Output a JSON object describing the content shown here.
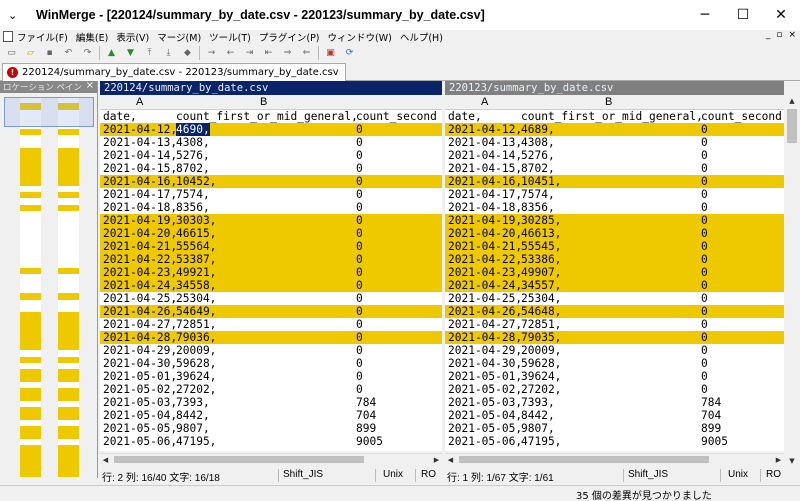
{
  "window": {
    "title": "WinMerge - [220124/summary_by_date.csv - 220123/summary_by_date.csv]",
    "sys_menu_glyph": "⌄",
    "controls": {
      "minimize": "─",
      "maximize": "☐",
      "close": "✕"
    }
  },
  "menu": {
    "items": [
      "ファイル(F)",
      "編集(E)",
      "表示(V)",
      "マージ(M)",
      "ツール(T)",
      "プラグイン(P)",
      "ウィンドウ(W)",
      "ヘルプ(H)"
    ],
    "mdi": {
      "minimize": "_",
      "restore": "▫",
      "close": "×"
    }
  },
  "toolbar": {
    "icons": [
      "new-icon",
      "open-icon",
      "save-icon",
      "undo-icon",
      "redo-icon",
      "previous-diff-icon",
      "next-diff-icon",
      "first-diff-icon",
      "last-diff-icon",
      "current-diff-icon",
      "copy-right-icon",
      "copy-left-icon",
      "copy-right-advance-icon",
      "copy-left-advance-icon",
      "copy-all-right-icon",
      "copy-all-left-icon",
      "options-icon",
      "refresh-icon"
    ]
  },
  "tab": {
    "label": "220124/summary_by_date.csv - 220123/summary_by_date.csv"
  },
  "location_pane": {
    "title": "ロケーション ペイン",
    "close": "×"
  },
  "colors": {
    "diff": "#efc900",
    "active_header": "#0a246a",
    "inactive_header": "#808080"
  },
  "left": {
    "path": "220124/summary_by_date.csv",
    "col_a": "A",
    "col_b": "B",
    "rows": [
      {
        "c1": "date,",
        "c2": "count_first_or_mid_general,",
        "c3": "count_second",
        "diff": false
      },
      {
        "c1": "2021-04-12,",
        "c2": "4690,",
        "c3": "0",
        "diff": true
      },
      {
        "c1": "2021-04-13,",
        "c2": "4308,",
        "c3": "0",
        "diff": false
      },
      {
        "c1": "2021-04-14,",
        "c2": "5276,",
        "c3": "0",
        "diff": false
      },
      {
        "c1": "2021-04-15,",
        "c2": "8702,",
        "c3": "0",
        "diff": false
      },
      {
        "c1": "2021-04-16,",
        "c2": "10452,",
        "c3": "0",
        "diff": true
      },
      {
        "c1": "2021-04-17,",
        "c2": "7574,",
        "c3": "0",
        "diff": false
      },
      {
        "c1": "2021-04-18,",
        "c2": "8356,",
        "c3": "0",
        "diff": false
      },
      {
        "c1": "2021-04-19,",
        "c2": "30303,",
        "c3": "0",
        "diff": true
      },
      {
        "c1": "2021-04-20,",
        "c2": "46615,",
        "c3": "0",
        "diff": true
      },
      {
        "c1": "2021-04-21,",
        "c2": "55564,",
        "c3": "0",
        "diff": true
      },
      {
        "c1": "2021-04-22,",
        "c2": "53387,",
        "c3": "0",
        "diff": true
      },
      {
        "c1": "2021-04-23,",
        "c2": "49921,",
        "c3": "0",
        "diff": true
      },
      {
        "c1": "2021-04-24,",
        "c2": "34558,",
        "c3": "0",
        "diff": true
      },
      {
        "c1": "2021-04-25,",
        "c2": "25304,",
        "c3": "0",
        "diff": false
      },
      {
        "c1": "2021-04-26,",
        "c2": "54649,",
        "c3": "0",
        "diff": true
      },
      {
        "c1": "2021-04-27,",
        "c2": "72851,",
        "c3": "0",
        "diff": false
      },
      {
        "c1": "2021-04-28,",
        "c2": "79036,",
        "c3": "0",
        "diff": true
      },
      {
        "c1": "2021-04-29,",
        "c2": "20009,",
        "c3": "0",
        "diff": false
      },
      {
        "c1": "2021-04-30,",
        "c2": "59628,",
        "c3": "0",
        "diff": false
      },
      {
        "c1": "2021-05-01,",
        "c2": "39624,",
        "c3": "0",
        "diff": false
      },
      {
        "c1": "2021-05-02,",
        "c2": "27202,",
        "c3": "0",
        "diff": false
      },
      {
        "c1": "2021-05-03,",
        "c2": "7393,",
        "c3": "784",
        "diff": false
      },
      {
        "c1": "2021-05-04,",
        "c2": "8442,",
        "c3": "704",
        "diff": false
      },
      {
        "c1": "2021-05-05,",
        "c2": "9807,",
        "c3": "899",
        "diff": false
      },
      {
        "c1": "2021-05-06,",
        "c2": "47195,",
        "c3": "9005",
        "diff": false
      }
    ],
    "status": {
      "pos": "行: 2  列: 16/40  文字: 16/18",
      "encoding": "Shift_JIS",
      "eol": "Unix",
      "ro": "RO"
    }
  },
  "right": {
    "path": "220123/summary_by_date.csv",
    "col_a": "A",
    "col_b": "B",
    "rows": [
      {
        "c1": "date,",
        "c2": "count_first_or_mid_general,",
        "c3": "count_second",
        "diff": false
      },
      {
        "c1": "2021-04-12,",
        "c2": "4689,",
        "c3": "0",
        "diff": true
      },
      {
        "c1": "2021-04-13,",
        "c2": "4308,",
        "c3": "0",
        "diff": false
      },
      {
        "c1": "2021-04-14,",
        "c2": "5276,",
        "c3": "0",
        "diff": false
      },
      {
        "c1": "2021-04-15,",
        "c2": "8702,",
        "c3": "0",
        "diff": false
      },
      {
        "c1": "2021-04-16,",
        "c2": "10451,",
        "c3": "0",
        "diff": true
      },
      {
        "c1": "2021-04-17,",
        "c2": "7574,",
        "c3": "0",
        "diff": false
      },
      {
        "c1": "2021-04-18,",
        "c2": "8356,",
        "c3": "0",
        "diff": false
      },
      {
        "c1": "2021-04-19,",
        "c2": "30285,",
        "c3": "0",
        "diff": true
      },
      {
        "c1": "2021-04-20,",
        "c2": "46613,",
        "c3": "0",
        "diff": true
      },
      {
        "c1": "2021-04-21,",
        "c2": "55545,",
        "c3": "0",
        "diff": true
      },
      {
        "c1": "2021-04-22,",
        "c2": "53386,",
        "c3": "0",
        "diff": true
      },
      {
        "c1": "2021-04-23,",
        "c2": "49907,",
        "c3": "0",
        "diff": true
      },
      {
        "c1": "2021-04-24,",
        "c2": "34557,",
        "c3": "0",
        "diff": true
      },
      {
        "c1": "2021-04-25,",
        "c2": "25304,",
        "c3": "0",
        "diff": false
      },
      {
        "c1": "2021-04-26,",
        "c2": "54648,",
        "c3": "0",
        "diff": true
      },
      {
        "c1": "2021-04-27,",
        "c2": "72851,",
        "c3": "0",
        "diff": false
      },
      {
        "c1": "2021-04-28,",
        "c2": "79035,",
        "c3": "0",
        "diff": true
      },
      {
        "c1": "2021-04-29,",
        "c2": "20009,",
        "c3": "0",
        "diff": false
      },
      {
        "c1": "2021-04-30,",
        "c2": "59628,",
        "c3": "0",
        "diff": false
      },
      {
        "c1": "2021-05-01,",
        "c2": "39624,",
        "c3": "0",
        "diff": false
      },
      {
        "c1": "2021-05-02,",
        "c2": "27202,",
        "c3": "0",
        "diff": false
      },
      {
        "c1": "2021-05-03,",
        "c2": "7393,",
        "c3": "784",
        "diff": false
      },
      {
        "c1": "2021-05-04,",
        "c2": "8442,",
        "c3": "704",
        "diff": false
      },
      {
        "c1": "2021-05-05,",
        "c2": "9807,",
        "c3": "899",
        "diff": false
      },
      {
        "c1": "2021-05-06,",
        "c2": "47195,",
        "c3": "9005",
        "diff": false
      }
    ],
    "status": {
      "pos": "行: 1  列: 1/67  文字: 1/61",
      "encoding": "Shift_JIS",
      "eol": "Unix",
      "ro": "RO"
    }
  },
  "status": {
    "diff_count": "35 個の差異が見つかりました"
  }
}
